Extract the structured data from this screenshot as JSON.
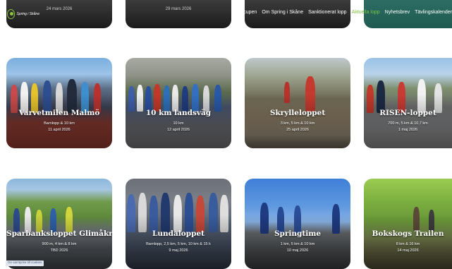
{
  "header": {
    "logo_text": "Spring i Skåne",
    "nav": [
      {
        "label": "Trailcupen",
        "active": false
      },
      {
        "label": "Om Spring i Skåne",
        "active": false
      },
      {
        "label": "Sanktionerat lopp",
        "active": false
      },
      {
        "label": "Aktuella lopp",
        "active": true
      },
      {
        "label": "Nyhetsbrev",
        "active": false
      },
      {
        "label": "Tävlingskalender",
        "active": false
      }
    ]
  },
  "top_cards": [
    {
      "date": "24 mars 2026"
    },
    {
      "date": "29 mars 2026"
    },
    {
      "date": ""
    },
    {
      "date": ""
    }
  ],
  "events": [
    {
      "title": "Varvetmilen Malmö",
      "distances": "Barnlopp & 10 km",
      "date": "11 april 2026"
    },
    {
      "title": "10 km landsväg",
      "distances": "10 km",
      "date": "12 april 2026"
    },
    {
      "title": "Skrylleloppet",
      "distances": "3 km, 5 km & 10 km",
      "date": "25 april 2026"
    },
    {
      "title": "RISEN-loppet",
      "distances": "700 m, 5 km & 10,7 km",
      "date": "1 maj 2026"
    },
    {
      "title": "Sparbanksloppet Glimåkra",
      "distances": "900 m, 4 km & 8 km",
      "date": "TBD 2026"
    },
    {
      "title": "Lundaloppet",
      "distances": "Barnlopp, 2,5 km, 5 km, 10 km & 15 k",
      "date": "9 maj 2026"
    },
    {
      "title": "Springtime",
      "distances": "1 km, 5 km & 10 km",
      "date": "10 maj 2026"
    },
    {
      "title": "Bokskogs Trailen",
      "distances": "8 km & 16 km",
      "date": "14 maj 2026"
    }
  ],
  "cookie_link": "Ge samtycke till cookies",
  "colors": {
    "nav_text": "#ffffff",
    "nav_active": "#7dc242",
    "accent_green": "#8cc63f",
    "card_title": "#ffffff"
  }
}
